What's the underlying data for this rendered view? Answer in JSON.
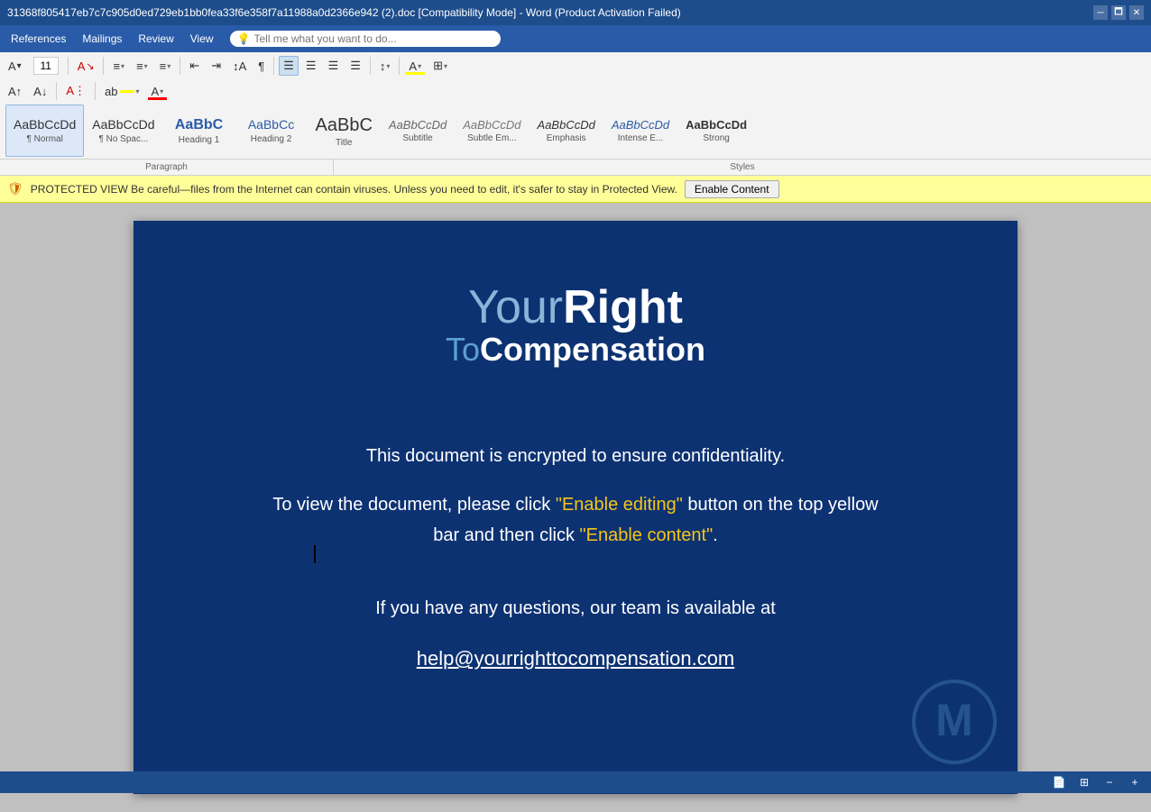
{
  "titlebar": {
    "title": "31368f805417eb7c7c905d0ed729eb1bb0fea33f6e358f7a11988a0d2366e942 (2).doc [Compatibility Mode] - Word (Product Activation Failed)",
    "maximize_icon": "🗖"
  },
  "menubar": {
    "items": [
      "References",
      "Mailings",
      "Review",
      "View"
    ],
    "search_placeholder": "Tell me what you want to do...",
    "search_icon": "💡"
  },
  "styles": {
    "items": [
      {
        "id": "normal",
        "preview": "AaBbCcDd",
        "label": "¶ Normal",
        "active": true
      },
      {
        "id": "no-spacing",
        "preview": "AaBbCcDd",
        "label": "¶ No Spac..."
      },
      {
        "id": "heading1",
        "preview": "AaBbC",
        "label": "Heading 1"
      },
      {
        "id": "heading2",
        "preview": "AaBbCc",
        "label": "Heading 2"
      },
      {
        "id": "title",
        "preview": "AaBbC",
        "label": "Title"
      },
      {
        "id": "subtitle",
        "preview": "AaBbCcDd",
        "label": "Subtitle"
      },
      {
        "id": "subtle-em",
        "preview": "AaBbCcDd",
        "label": "Subtle Em..."
      },
      {
        "id": "emphasis",
        "preview": "AaBbCcDd",
        "label": "Emphasis"
      },
      {
        "id": "intense-e",
        "preview": "AaBbCcDd",
        "label": "Intense E..."
      },
      {
        "id": "strong",
        "preview": "AaBbCcDd",
        "label": "Strong"
      }
    ],
    "section_label": "Styles"
  },
  "paragraph_label": "Paragraph",
  "notification": {
    "icon": "⚠",
    "enable_button": "Enable Content"
  },
  "document": {
    "logo_your": "Your",
    "logo_right": "Right",
    "logo_to": "To",
    "logo_compensation": "Compensation",
    "line1": "This document is encrypted to ensure confidentiality.",
    "line2_before": "To view the document, please click ",
    "line2_highlight1": "\"Enable editing\"",
    "line2_middle": " button on the top yellow",
    "line2_before2": "bar and then click ",
    "line2_highlight2": "\"Enable content\"",
    "line2_after": ".",
    "line3": "If you have any questions, our team is available at",
    "email": "help@yourrighttocompensation.com"
  },
  "bottom_bar": {
    "icons": [
      "page-icon",
      "layout-icon",
      "zoom-icon"
    ]
  }
}
